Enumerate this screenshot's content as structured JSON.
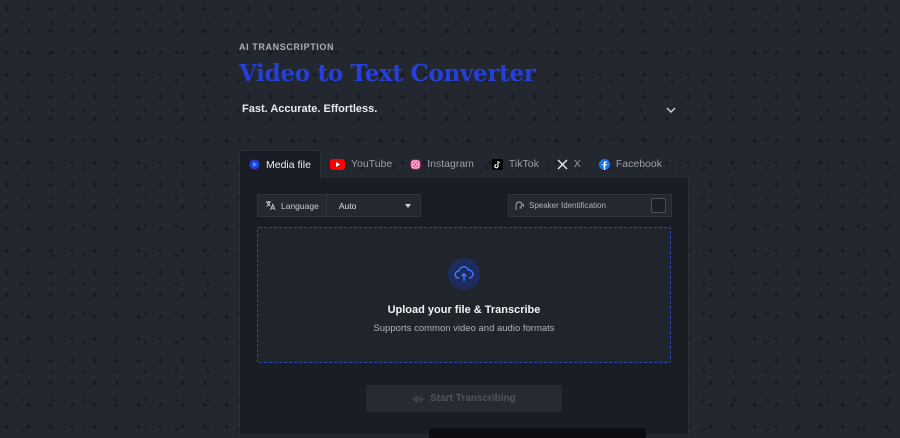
{
  "header": {
    "eyebrow": "AI TRANSCRIPTION",
    "title": "Video to Text Converter",
    "subtitle": "Fast. Accurate. Effortless.",
    "expand_icon": "chevron-down-icon"
  },
  "tabs": [
    {
      "label": "Media file",
      "icon": "media-file-icon",
      "active": true
    },
    {
      "label": "YouTube",
      "icon": "youtube-icon",
      "active": false,
      "color": "#ff0000"
    },
    {
      "label": "Instagram",
      "icon": "instagram-icon",
      "active": false,
      "color": "#d62976"
    },
    {
      "label": "TikTok",
      "icon": "tiktok-icon",
      "active": false
    },
    {
      "label": "X",
      "icon": "x-icon",
      "active": false
    },
    {
      "label": "Facebook",
      "icon": "facebook-icon",
      "active": false,
      "color": "#1877f2"
    }
  ],
  "language": {
    "label": "Language",
    "value": "Auto",
    "icon": "translate-icon"
  },
  "speaker": {
    "label": "Speaker Identification",
    "icon": "speaker-icon",
    "enabled": false
  },
  "upload": {
    "title": "Upload your file & Transcribe",
    "subtitle": "Supports common video and audio formats",
    "icon": "cloud-upload-icon"
  },
  "start_button": {
    "label": "Start Transcribing",
    "icon": "waveform-icon",
    "disabled": true
  },
  "colors": {
    "accent": "#2540d8",
    "background": "#23272f",
    "panel": "#1a1d23"
  }
}
